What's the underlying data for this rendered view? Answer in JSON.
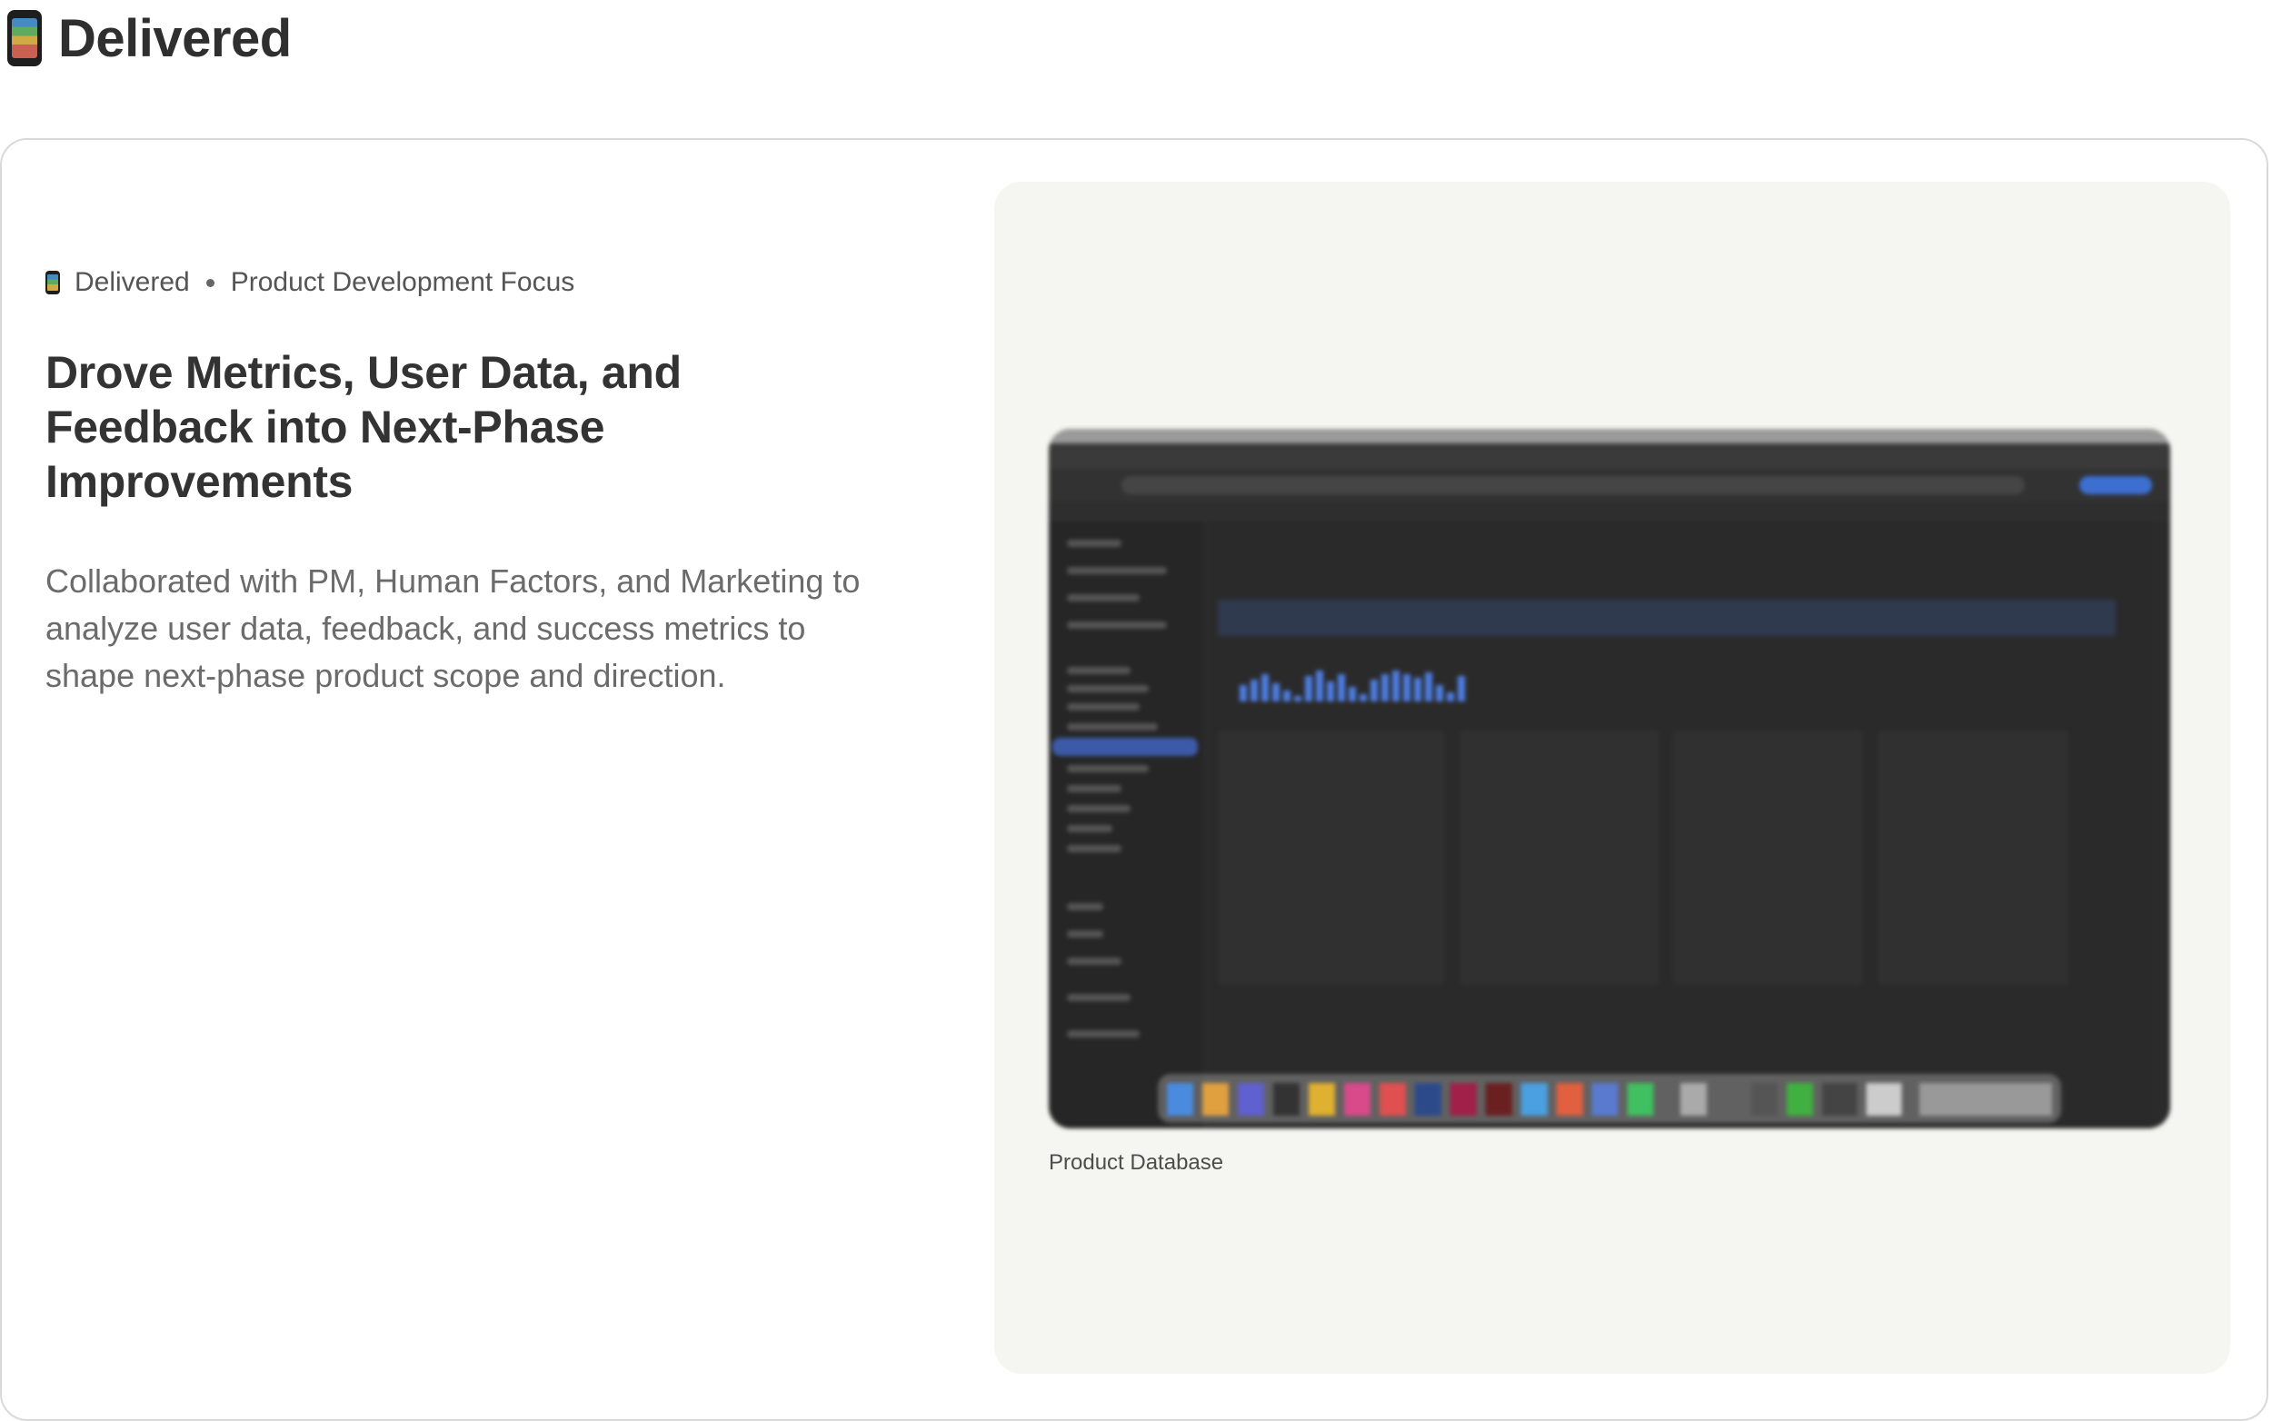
{
  "page": {
    "icon": "mobile-phone-icon",
    "title": "Delivered"
  },
  "card": {
    "meta": {
      "icon": "mobile-phone-icon",
      "status": "Delivered",
      "category": "Product Development Focus"
    },
    "heading": "Drove Metrics, User Data, and Feedback into Next-Phase Improvements",
    "description": "Collaborated with PM, Human Factors, and Marketing to analyze user data, feedback, and success metrics to shape next-phase product scope and direction.",
    "media": {
      "caption": "Product Database"
    }
  },
  "colors": {
    "title_text": "#2f2f2f",
    "body_text": "#6b6b6b",
    "card_border": "#d9d9d9",
    "media_panel_bg": "#f5f5f1",
    "screenshot_bg": "#2b2b2b",
    "accent_blue": "#4e7de0"
  }
}
